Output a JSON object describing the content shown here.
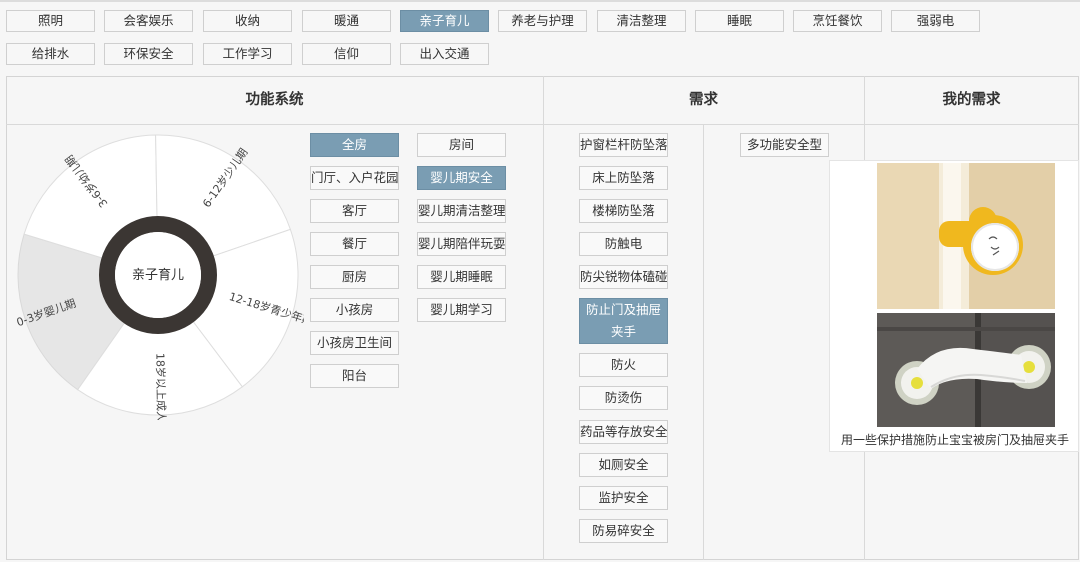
{
  "categories": [
    {
      "label": "照明",
      "active": false
    },
    {
      "label": "会客娱乐",
      "active": false
    },
    {
      "label": "收纳",
      "active": false
    },
    {
      "label": "暖通",
      "active": false
    },
    {
      "label": "亲子育儿",
      "active": true
    },
    {
      "label": "养老与护理",
      "active": false
    },
    {
      "label": "清洁整理",
      "active": false
    },
    {
      "label": "睡眠",
      "active": false
    },
    {
      "label": "烹饪餐饮",
      "active": false
    },
    {
      "label": "强弱电",
      "active": false
    },
    {
      "label": "给排水",
      "active": false
    },
    {
      "label": "环保安全",
      "active": false
    },
    {
      "label": "工作学习",
      "active": false
    },
    {
      "label": "信仰",
      "active": false
    },
    {
      "label": "出入交通",
      "active": false
    }
  ],
  "columns": {
    "function_system": "功能系统",
    "needs": "需求",
    "my_needs": "我的需求"
  },
  "wheel": {
    "center_label": "亲子育儿",
    "segments": [
      {
        "label": "0-3岁婴儿期",
        "active": true
      },
      {
        "label": "3-6岁幼儿期",
        "active": false
      },
      {
        "label": "6-12岁少儿期",
        "active": false
      },
      {
        "label": "12-18岁青少年期",
        "active": false
      },
      {
        "label": "18岁以上成人期",
        "active": false
      }
    ]
  },
  "rooms": [
    {
      "label": "全房",
      "active": true
    },
    {
      "label": "门厅、入户花园",
      "active": false
    },
    {
      "label": "客厅",
      "active": false
    },
    {
      "label": "餐厅",
      "active": false
    },
    {
      "label": "厨房",
      "active": false
    },
    {
      "label": "小孩房",
      "active": false
    },
    {
      "label": "小孩房卫生间",
      "active": false
    },
    {
      "label": "阳台",
      "active": false
    }
  ],
  "subsystems": [
    {
      "label": "房间",
      "active": false
    },
    {
      "label": "婴儿期安全",
      "active": true
    },
    {
      "label": "婴儿期清洁整理",
      "active": false
    },
    {
      "label": "婴儿期陪伴玩耍",
      "active": false
    },
    {
      "label": "婴儿期睡眠",
      "active": false
    },
    {
      "label": "婴儿期学习",
      "active": false
    }
  ],
  "needs": [
    {
      "label": "护窗栏杆防坠落",
      "active": false
    },
    {
      "label": "床上防坠落",
      "active": false
    },
    {
      "label": "楼梯防坠落",
      "active": false
    },
    {
      "label": "防触电",
      "active": false
    },
    {
      "label": "防尖锐物体磕碰",
      "active": false
    },
    {
      "label": "防止门及抽屉夹手",
      "active": true
    },
    {
      "label": "防火",
      "active": false
    },
    {
      "label": "防烫伤",
      "active": false
    },
    {
      "label": "药品等存放安全",
      "active": false
    },
    {
      "label": "如厕安全",
      "active": false
    },
    {
      "label": "监护安全",
      "active": false
    },
    {
      "label": "防易碎安全",
      "active": false
    }
  ],
  "need_option": "多功能安全型",
  "product_caption": "用一些保护措施防止宝宝被房门及抽屉夹手",
  "colors": {
    "accent": "#7a9db3",
    "ring": "#3b3633",
    "wheel_active": "#e6e6e6",
    "knob_yellow": "#f0b81e",
    "door_wood": "#e8d9b8",
    "cabinet": "#5d5a57"
  }
}
